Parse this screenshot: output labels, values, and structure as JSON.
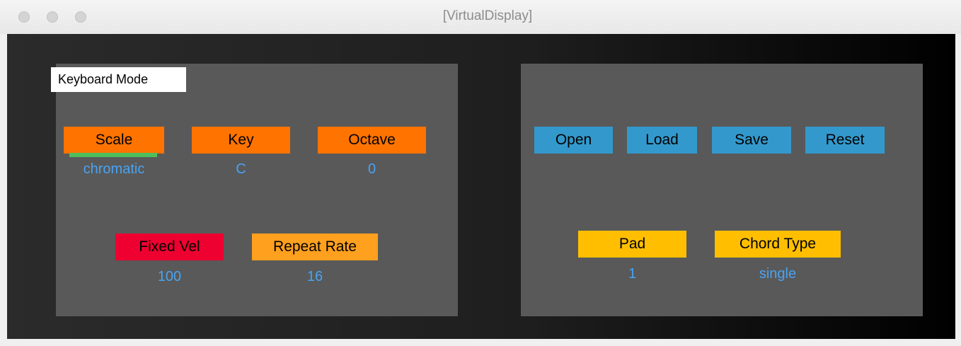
{
  "window": {
    "title": "[VirtualDisplay]"
  },
  "left_panel": {
    "mode_label": "Keyboard Mode",
    "scale": {
      "label": "Scale",
      "value": "chromatic"
    },
    "key": {
      "label": "Key",
      "value": "C"
    },
    "octave": {
      "label": "Octave",
      "value": "0"
    },
    "fixed_vel": {
      "label": "Fixed Vel",
      "value": "100"
    },
    "repeat_rate": {
      "label": "Repeat Rate",
      "value": "16"
    }
  },
  "right_panel": {
    "open": "Open",
    "load": "Load",
    "save": "Save",
    "reset": "Reset",
    "pad": {
      "label": "Pad",
      "value": "1"
    },
    "chord_type": {
      "label": "Chord Type",
      "value": "single"
    }
  },
  "colors": {
    "orange": "#ff7300",
    "blue": "#3399cc",
    "yellow": "#ffbf00",
    "red": "#ee0030",
    "value_text": "#49a3f2",
    "indicator": "#4fbf5c"
  }
}
